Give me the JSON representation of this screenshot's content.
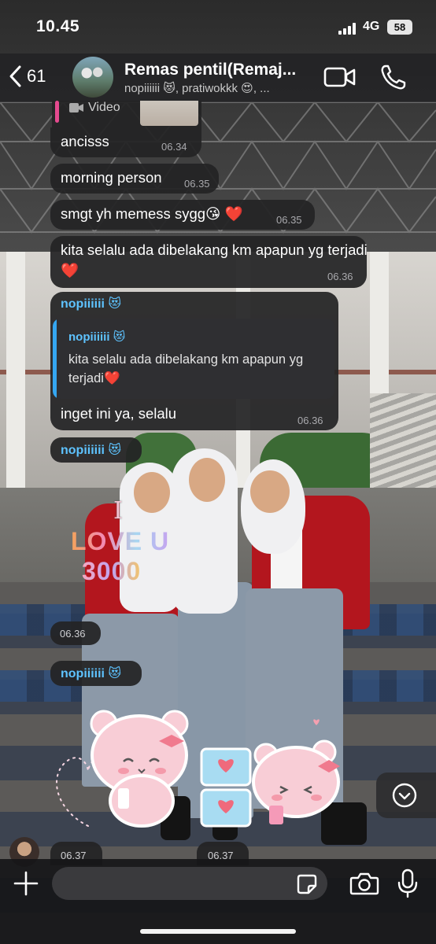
{
  "status_bar": {
    "time": "10.45",
    "network": "4G",
    "battery": "58"
  },
  "header": {
    "back_count": "61",
    "group_name": "Remas pentil(Remaj...",
    "members": "nopiiiiii 😻, pratiwokkk 😍, ..."
  },
  "media_message": {
    "label": "Video"
  },
  "messages": [
    {
      "text": "ancisss",
      "time": "06.34"
    },
    {
      "text": "morning person",
      "time": "06.35"
    },
    {
      "text": "smgt yh memess sygg😘 ❤️",
      "time": "06.35"
    },
    {
      "text": "kita selalu ada dibelakang km apapun yg terjadi❤️",
      "time": "06.36"
    }
  ],
  "reply_message": {
    "sender": "nopiiiiii 😻",
    "quote_sender": "nopiiiiii 😻",
    "quote_text": "kita selalu ada dibelakang km apapun yg terjadi❤️",
    "text": "inget ini ya, selalu",
    "time": "06.36"
  },
  "sticker_message_1": {
    "sender": "nopiiiiii 😻",
    "sticker_text_line1": "I",
    "sticker_text_line2": "LOVE U",
    "sticker_text_line3": "3000",
    "time": "06.36"
  },
  "sticker_message_2": {
    "sender": "nopiiiiii 😻",
    "time_left": "06.37",
    "time_right": "06.37"
  },
  "composer": {
    "placeholder": ""
  },
  "colors": {
    "sender": "#5ec3ff",
    "bubble": "#232325",
    "quote_bar": "#35a7f2",
    "jacket": "#b3161e"
  },
  "icons": [
    "chevron-left-icon",
    "video-camera-icon",
    "phone-icon",
    "chevron-down-icon",
    "plus-icon",
    "sticker-icon",
    "camera-icon",
    "microphone-icon"
  ]
}
